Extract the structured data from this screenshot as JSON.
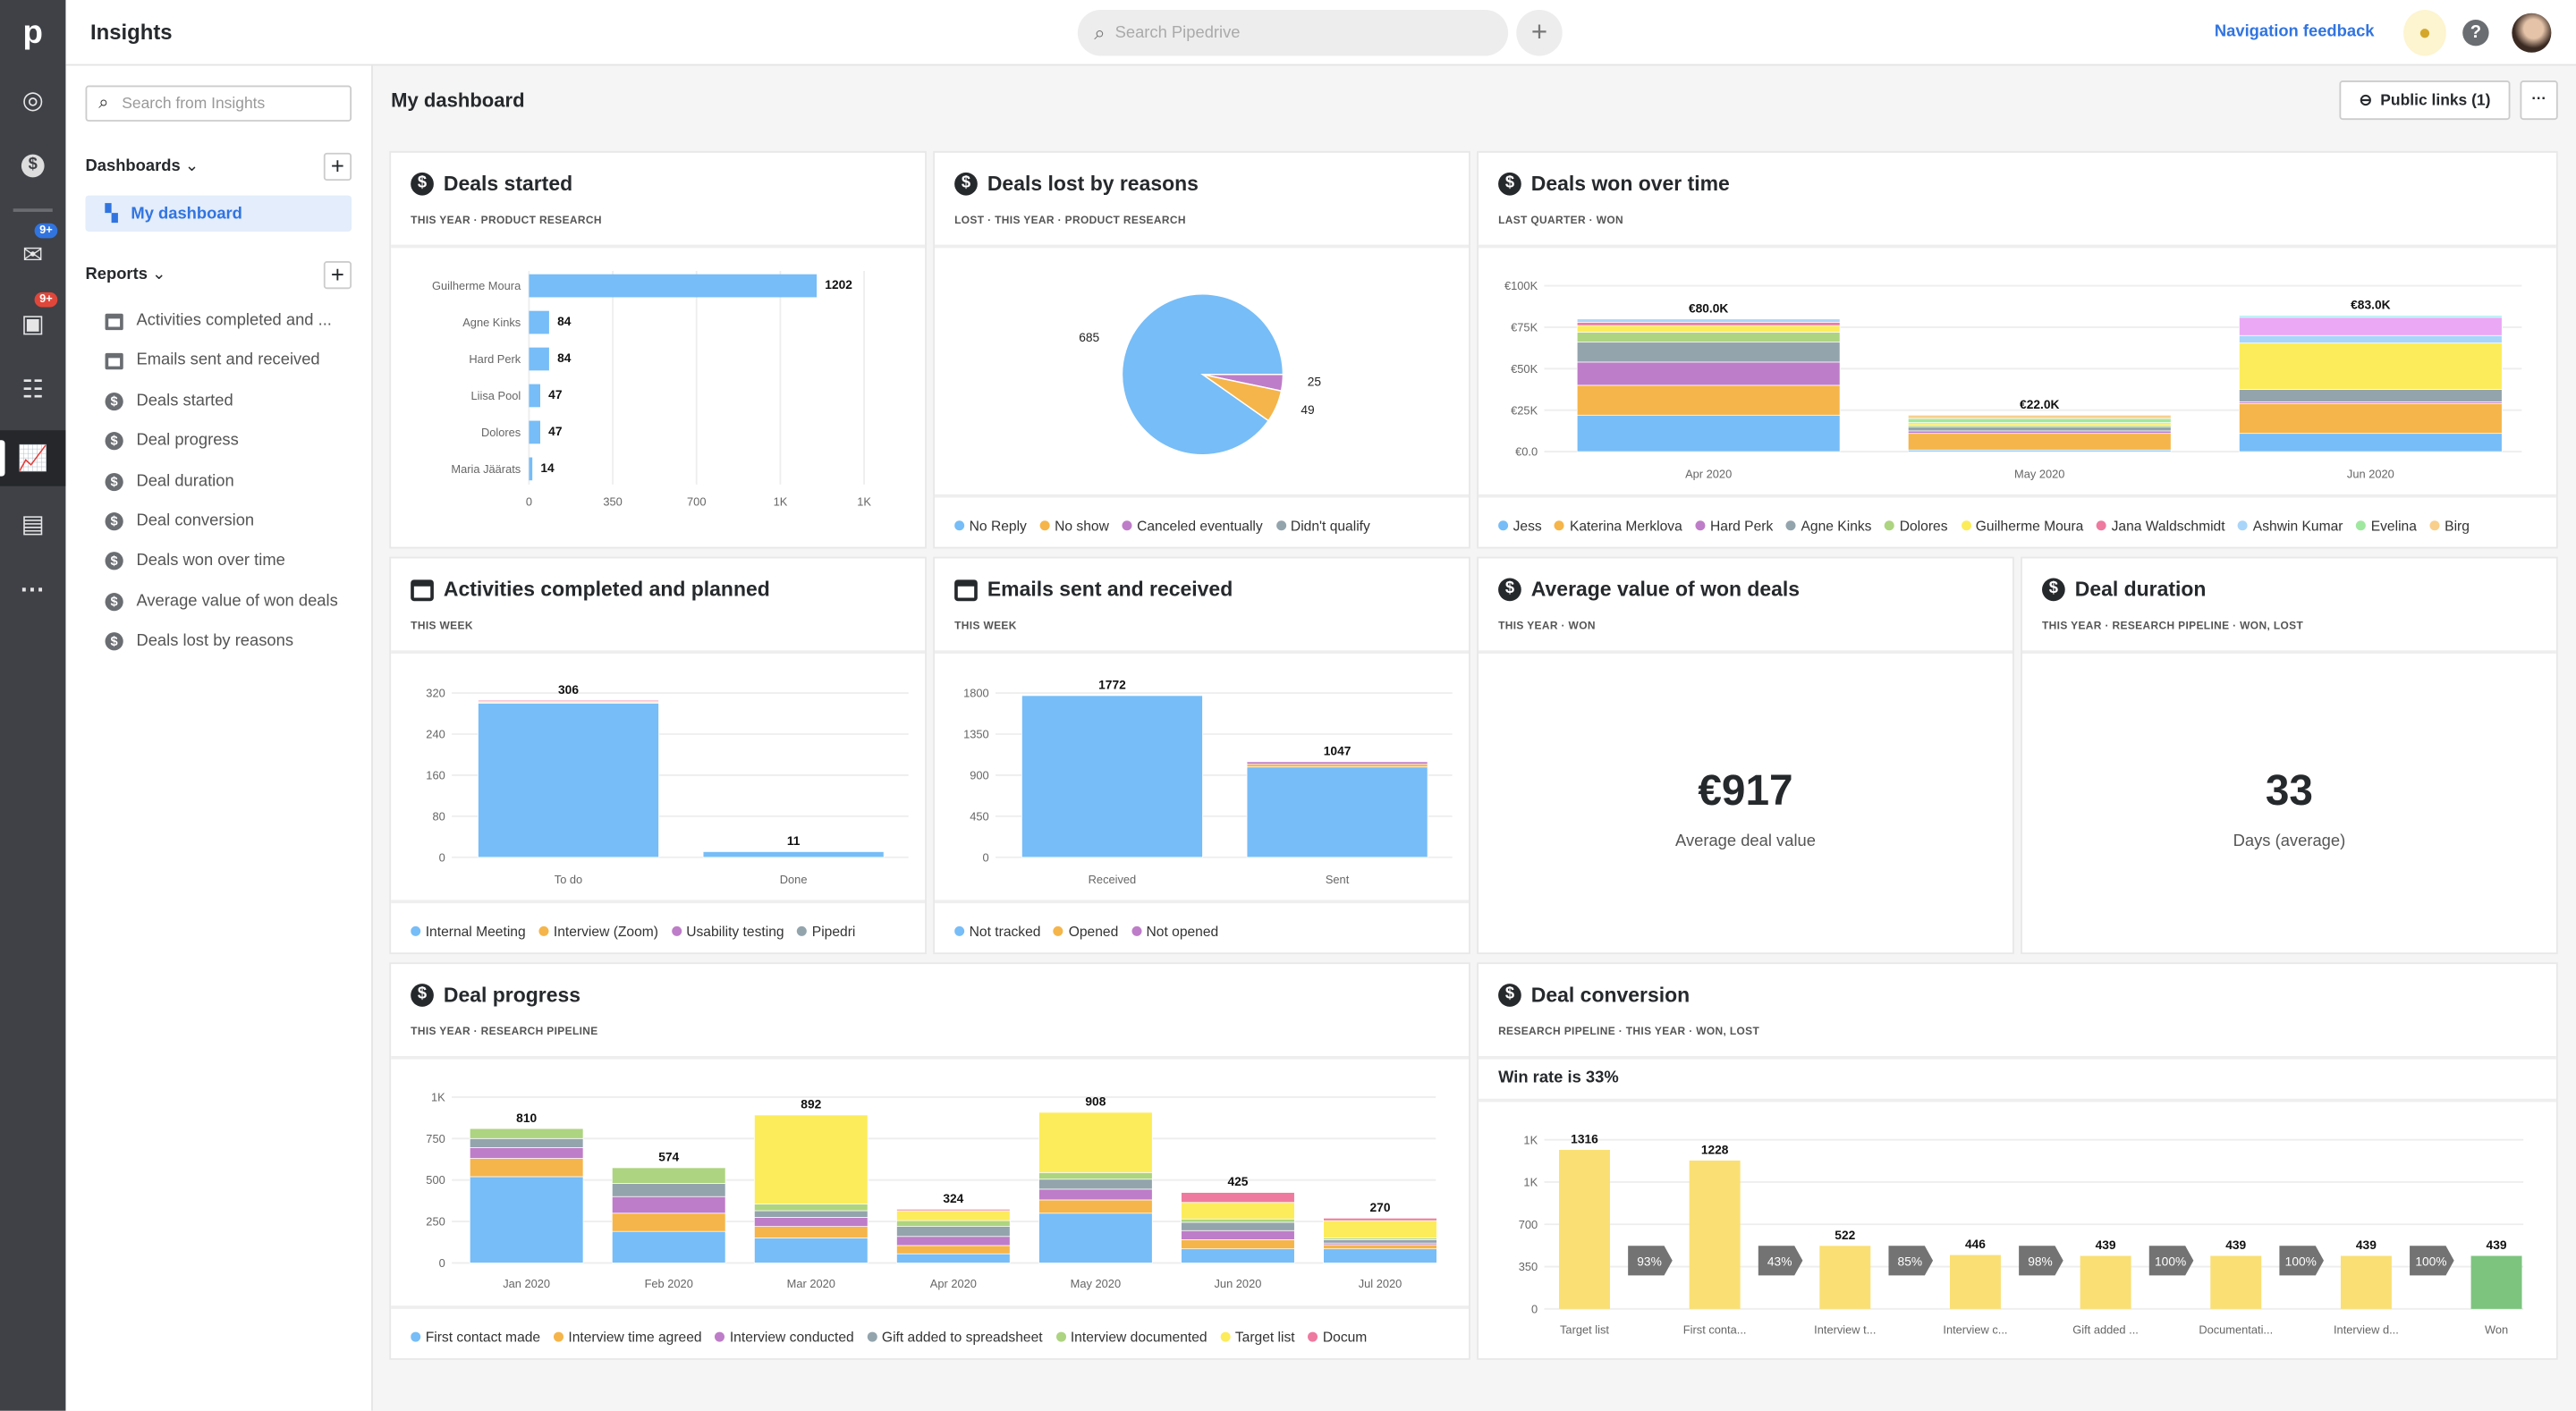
{
  "app": {
    "title": "Insights",
    "search_placeholder": "Search Pipedrive",
    "nav_feedback": "Navigation feedback",
    "badges": {
      "mail": "9+",
      "activities": "9+"
    }
  },
  "sidebar": {
    "search_placeholder": "Search from Insights",
    "dashboards_label": "Dashboards",
    "dashboards": [
      {
        "label": "My dashboard",
        "active": true
      }
    ],
    "reports_label": "Reports",
    "reports": [
      {
        "label": "Activities completed and ...",
        "icon": "calendar-icon"
      },
      {
        "label": "Emails sent and received",
        "icon": "calendar-icon"
      },
      {
        "label": "Deals started",
        "icon": "dollar-icon"
      },
      {
        "label": "Deal progress",
        "icon": "dollar-icon"
      },
      {
        "label": "Deal duration",
        "icon": "dollar-icon"
      },
      {
        "label": "Deal conversion",
        "icon": "dollar-icon"
      },
      {
        "label": "Deals won over time",
        "icon": "dollar-icon"
      },
      {
        "label": "Average value of won deals",
        "icon": "dollar-icon"
      },
      {
        "label": "Deals lost by reasons",
        "icon": "dollar-icon"
      }
    ]
  },
  "main": {
    "title": "My dashboard",
    "public_links": "Public links (1)",
    "more": "···"
  },
  "colors": {
    "accent": "#3174e0",
    "active_bg": "#e3edfb",
    "blue": "#77bdf7",
    "orange": "#f5b54a",
    "purple": "#be7dc8",
    "gray": "#93a4ad",
    "green": "#add480",
    "yellow": "#fcec5b",
    "pink": "#ee7aa0",
    "lightblue": "#a9d5fa",
    "lightgreen": "#9fe8a0",
    "peach": "#f9cf8c",
    "lavender": "#eaa8f5",
    "cyan": "#8fe8f3",
    "funnel_yellow": "#fadf74",
    "funnel_green": "#7dc47f",
    "arrow": "#737373"
  },
  "cards": {
    "deals_started": {
      "title": "Deals started",
      "subtitle": "THIS YEAR  ·  PRODUCT RESEARCH"
    },
    "deals_lost": {
      "title": "Deals lost by reasons",
      "subtitle": "LOST  ·  THIS YEAR  ·  PRODUCT RESEARCH"
    },
    "deals_won": {
      "title": "Deals won over time",
      "subtitle": "LAST QUARTER  ·  WON"
    },
    "activities": {
      "title": "Activities completed and planned",
      "subtitle": "THIS WEEK"
    },
    "emails": {
      "title": "Emails sent and received",
      "subtitle": "THIS WEEK"
    },
    "avg_value": {
      "title": "Average value of won deals",
      "subtitle": "THIS YEAR  ·  WON",
      "value": "€917",
      "label": "Average deal value"
    },
    "duration": {
      "title": "Deal duration",
      "subtitle": "THIS YEAR  ·  RESEARCH PIPELINE  ·  WON, LOST",
      "value": "33",
      "label": "Days (average)"
    },
    "progress": {
      "title": "Deal progress",
      "subtitle": "THIS YEAR  ·  RESEARCH PIPELINE"
    },
    "conversion": {
      "title": "Deal conversion",
      "subtitle": "RESEARCH PIPELINE  ·  THIS YEAR  ·  WON, LOST",
      "win_rate": "Win rate is 33%"
    }
  },
  "chart_data": [
    {
      "id": "deals_started",
      "type": "bar",
      "orientation": "horizontal",
      "categories": [
        "Guilherme Moura",
        "Agne Kinks",
        "Hard Perk",
        "Liisa Pool",
        "Dolores",
        "Maria Jäärats"
      ],
      "values": [
        1202,
        84,
        84,
        47,
        47,
        14
      ],
      "xlim": [
        0,
        1400
      ],
      "xticks": [
        "0",
        "350",
        "700",
        "1K",
        "1K"
      ],
      "grid": true
    },
    {
      "id": "deals_lost",
      "type": "pie",
      "labels": [
        "No Reply",
        "No show",
        "Canceled eventually",
        "Didn't qualify"
      ],
      "values": [
        685,
        49,
        25,
        0
      ],
      "colors": [
        "#77bdf7",
        "#f5b54a",
        "#be7dc8",
        "#93a4ad"
      ],
      "legend": "bottom"
    },
    {
      "id": "deals_won",
      "type": "bar",
      "stacked": true,
      "categories": [
        "Apr 2020",
        "May 2020",
        "Jun 2020"
      ],
      "totals": [
        "€80.0K",
        "€22.0K",
        "€83.0K"
      ],
      "ylim": [
        0,
        100
      ],
      "yticks": [
        "€0.0",
        "€25K",
        "€50K",
        "€75K",
        "€100K"
      ],
      "legend": "bottom",
      "series": [
        {
          "name": "Jess",
          "color": "#77bdf7",
          "values": [
            22,
            1,
            11
          ]
        },
        {
          "name": "Katerina Merklova",
          "color": "#f5b54a",
          "values": [
            18,
            10,
            18
          ]
        },
        {
          "name": "Hard Perk",
          "color": "#be7dc8",
          "values": [
            14,
            1.5,
            1
          ]
        },
        {
          "name": "Agne Kinks",
          "color": "#93a4ad",
          "values": [
            12,
            2.5,
            7.5
          ]
        },
        {
          "name": "Dolores",
          "color": "#add480",
          "values": [
            6,
            1,
            0
          ]
        },
        {
          "name": "Guilherme Moura",
          "color": "#fcec5b",
          "values": [
            4,
            1.5,
            28
          ]
        },
        {
          "name": "Jana Waldschmidt",
          "color": "#ee7aa0",
          "values": [
            2,
            0,
            0
          ]
        },
        {
          "name": "Ashwin Kumar",
          "color": "#a9d5fa",
          "values": [
            2,
            0,
            4.5
          ]
        },
        {
          "name": "Evelina",
          "color": "#9fe8a0",
          "values": [
            0,
            2.5,
            0
          ]
        },
        {
          "name": "Birg",
          "color": "#f9cf8c",
          "values": [
            0,
            2,
            0
          ]
        },
        {
          "color": "#eaa8f5",
          "values": [
            0,
            0,
            11
          ]
        },
        {
          "color": "#8fe8f3",
          "values": [
            0,
            0,
            1
          ]
        }
      ]
    },
    {
      "id": "activities",
      "type": "bar",
      "stacked": true,
      "categories": [
        "To do",
        "Done"
      ],
      "totals": [
        "306",
        "11"
      ],
      "ylim": [
        0,
        320
      ],
      "yticks": [
        "0",
        "80",
        "160",
        "240",
        "320"
      ],
      "legend": "bottom",
      "series": [
        {
          "name": "Internal Meeting",
          "color": "#77bdf7",
          "values": [
            300,
            11
          ]
        },
        {
          "name": "Interview (Zoom)",
          "color": "#f5b54a",
          "values": [
            2,
            0
          ]
        },
        {
          "name": "Usability testing",
          "color": "#be7dc8",
          "values": [
            2,
            0
          ]
        },
        {
          "name": "Pipedri",
          "color": "#93a4ad",
          "values": [
            0,
            0
          ]
        },
        {
          "color": "#ee7aa0",
          "values": [
            2,
            0
          ]
        }
      ]
    },
    {
      "id": "emails",
      "type": "bar",
      "stacked": true,
      "categories": [
        "Received",
        "Sent"
      ],
      "totals": [
        "1772",
        "1047"
      ],
      "ylim": [
        0,
        1800
      ],
      "yticks": [
        "0",
        "450",
        "900",
        "1350",
        "1800"
      ],
      "legend": "bottom",
      "series": [
        {
          "name": "Not tracked",
          "color": "#77bdf7",
          "values": [
            1772,
            990
          ]
        },
        {
          "name": "Opened",
          "color": "#f5b54a",
          "values": [
            0,
            30
          ]
        },
        {
          "name": "Not opened",
          "color": "#be7dc8",
          "values": [
            0,
            27
          ]
        }
      ]
    },
    {
      "id": "progress",
      "type": "bar",
      "stacked": true,
      "categories": [
        "Jan 2020",
        "Feb 2020",
        "Mar 2020",
        "Apr 2020",
        "May 2020",
        "Jun 2020",
        "Jul 2020"
      ],
      "totals": [
        "810",
        "574",
        "892",
        "324",
        "908",
        "425",
        "270"
      ],
      "ylim": [
        0,
        1000
      ],
      "yticks": [
        "0",
        "250",
        "500",
        "750",
        "1K"
      ],
      "legend": "bottom",
      "series": [
        {
          "name": "First contact made",
          "color": "#77bdf7",
          "values": [
            520,
            190,
            150,
            55,
            300,
            85,
            85
          ]
        },
        {
          "name": "Interview time agreed",
          "color": "#f5b54a",
          "values": [
            110,
            110,
            70,
            50,
            80,
            55,
            25
          ]
        },
        {
          "name": "Interview conducted",
          "color": "#be7dc8",
          "values": [
            65,
            100,
            55,
            55,
            65,
            55,
            10
          ]
        },
        {
          "name": "Gift added to spreadsheet",
          "color": "#93a4ad",
          "values": [
            55,
            80,
            40,
            60,
            60,
            50,
            20
          ]
        },
        {
          "name": "Interview documented",
          "color": "#add480",
          "values": [
            60,
            94,
            40,
            35,
            40,
            20,
            10
          ]
        },
        {
          "name": "Target list",
          "color": "#fcec5b",
          "values": [
            0,
            0,
            537,
            60,
            363,
            100,
            105
          ]
        },
        {
          "name": "Docum",
          "color": "#ee7aa0",
          "values": [
            0,
            0,
            0,
            9,
            0,
            60,
            15
          ]
        }
      ]
    },
    {
      "id": "conversion",
      "type": "bar",
      "categories": [
        "Target list",
        "First conta...",
        "Interview t...",
        "Interview c...",
        "Gift added ...",
        "Documentati...",
        "Interview d...",
        "Won"
      ],
      "values": [
        1316,
        1228,
        522,
        446,
        439,
        439,
        439,
        439
      ],
      "rates": [
        "93%",
        "43%",
        "85%",
        "98%",
        "100%",
        "100%",
        "100%"
      ],
      "ylim": [
        0,
        1400
      ],
      "yticks": [
        "0",
        "350",
        "700",
        "1K",
        "1K"
      ]
    }
  ]
}
